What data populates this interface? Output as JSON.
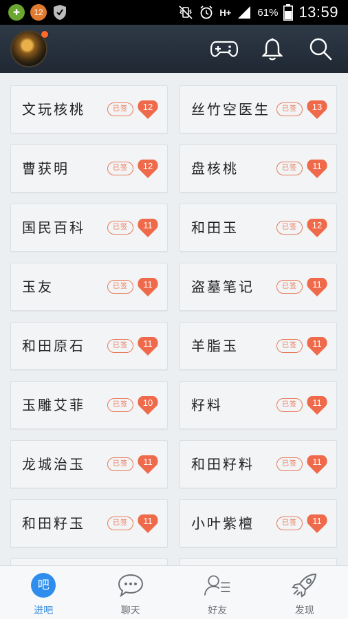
{
  "status_bar": {
    "notif_badge": "12",
    "battery_pct": "61%",
    "time": "13:59",
    "network_label": "H+"
  },
  "header": {
    "icons": [
      "gamepad-icon",
      "bell-icon",
      "search-icon"
    ]
  },
  "stamp_label": "已签",
  "cards": [
    {
      "name": "文玩核桃",
      "level": "12"
    },
    {
      "name": "丝竹空医生",
      "level": "13"
    },
    {
      "name": "曹获明",
      "level": "12"
    },
    {
      "name": "盘核桃",
      "level": "11"
    },
    {
      "name": "国民百科",
      "level": "11"
    },
    {
      "name": "和田玉",
      "level": "12"
    },
    {
      "name": "玉友",
      "level": "11"
    },
    {
      "name": "盗墓笔记",
      "level": "11"
    },
    {
      "name": "和田原石",
      "level": "11"
    },
    {
      "name": "羊脂玉",
      "level": "11"
    },
    {
      "name": "玉雕艾菲",
      "level": "10"
    },
    {
      "name": "籽料",
      "level": "11"
    },
    {
      "name": "龙城治玉",
      "level": "11"
    },
    {
      "name": "和田籽料",
      "level": "11"
    },
    {
      "name": "和田籽玉",
      "level": "11"
    },
    {
      "name": "小叶紫檀",
      "level": "11"
    }
  ],
  "tabbar": {
    "active_icon_text": "吧",
    "tabs": [
      {
        "label": "进吧",
        "icon": "enter-bar-icon",
        "active": true
      },
      {
        "label": "聊天",
        "icon": "chat-bubble-icon",
        "active": false
      },
      {
        "label": "好友",
        "icon": "friends-icon",
        "active": false
      },
      {
        "label": "发现",
        "icon": "rocket-icon",
        "active": false
      }
    ]
  },
  "colors": {
    "accent": "#2e8ded",
    "level_badge": "#ef6a4a",
    "stamp": "#e77a5a",
    "header_bg": "#27303b"
  }
}
